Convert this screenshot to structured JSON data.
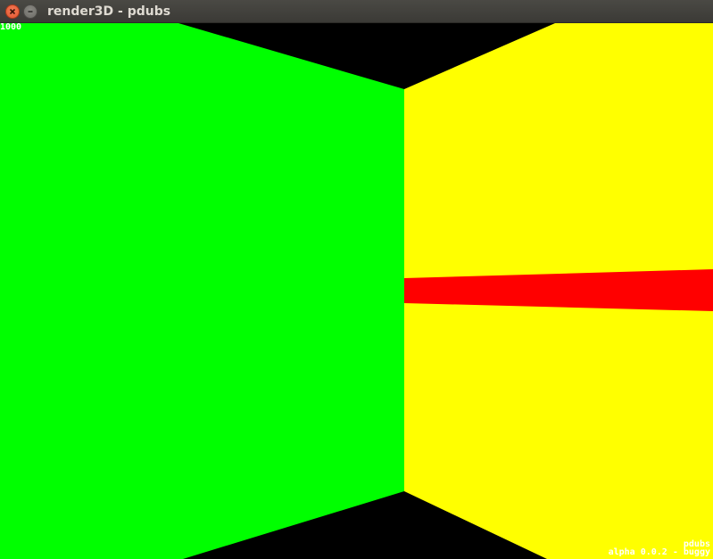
{
  "window": {
    "title": "render3D - pdubs"
  },
  "hud": {
    "counter": "1000",
    "version": "alpha 0.0.2 -",
    "author": "pdubs",
    "status": "buggy"
  },
  "colors": {
    "left_wall": "#00ff00",
    "right_wall": "#ffff00",
    "stripe": "#ff0000",
    "background": "#000000"
  },
  "icons": {
    "close": "close-icon",
    "minimize": "minimize-icon"
  }
}
